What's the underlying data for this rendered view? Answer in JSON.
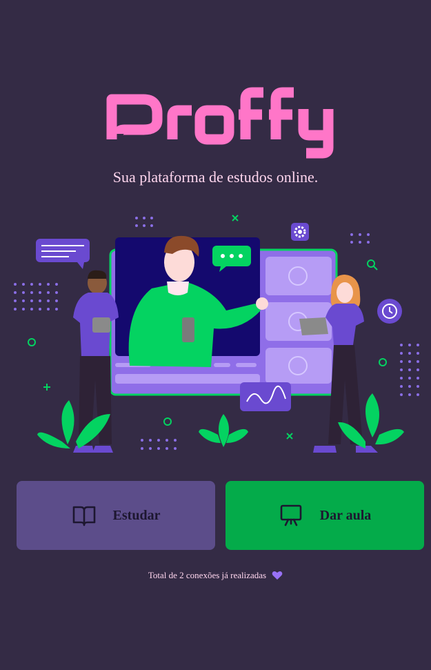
{
  "app": {
    "logo_text": "Proffy",
    "tagline": "Sua plataforma de estudos online."
  },
  "actions": {
    "study_label": "Estudar",
    "teach_label": "Dar aula"
  },
  "footer": {
    "total_connections_text": "Total de 2 conexões já realizadas"
  },
  "icons": {
    "study": "book-open-icon",
    "teach": "presentation-board-icon",
    "footer": "purple-heart-icon"
  },
  "colors": {
    "background": "#342b45",
    "logo": "#ff76c8",
    "tagline": "#ffd6ee",
    "study_button": "#5c4d8a",
    "teach_button": "#04ab4a",
    "heart": "#9871f5"
  }
}
